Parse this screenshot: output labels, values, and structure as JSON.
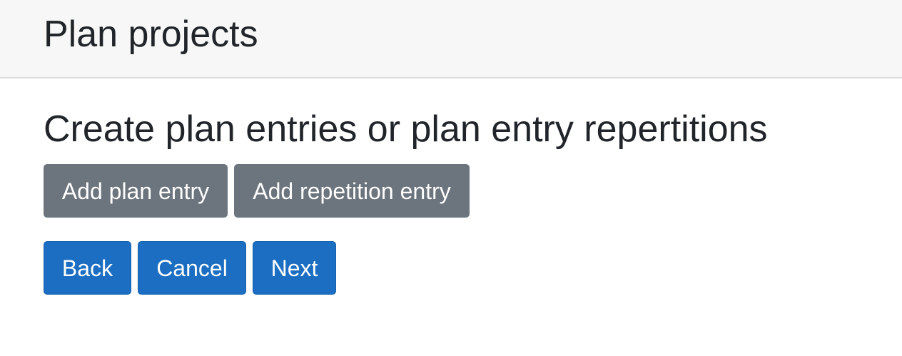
{
  "header": {
    "title": "Plan projects"
  },
  "main": {
    "heading": "Create plan entries or plan entry repertitions",
    "entry_actions": {
      "add_plan_entry_label": "Add plan entry",
      "add_repetition_entry_label": "Add repetition entry"
    },
    "navigation": {
      "back_label": "Back",
      "cancel_label": "Cancel",
      "next_label": "Next"
    }
  },
  "colors": {
    "header_background": "#f7f7f7",
    "secondary_button": "#6c757d",
    "primary_button": "#1b6ec2",
    "text": "#212529"
  }
}
